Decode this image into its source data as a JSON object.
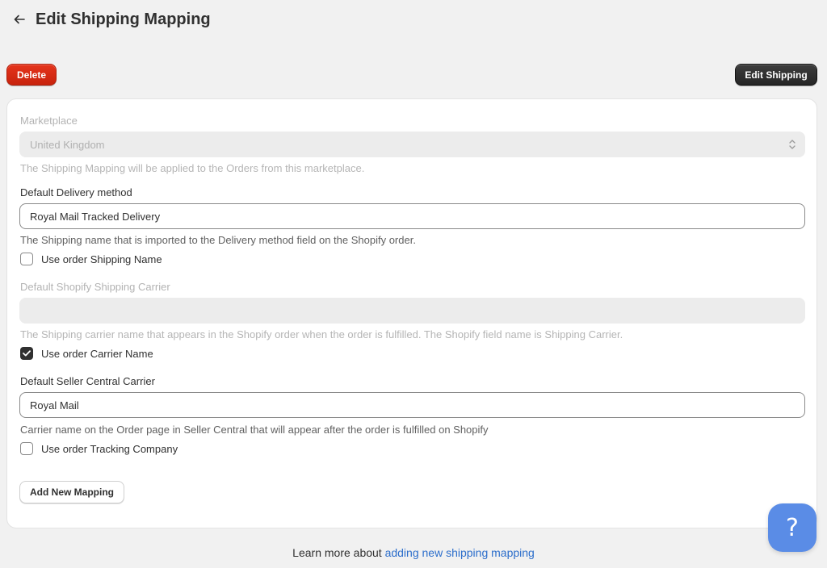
{
  "header": {
    "back_icon": "arrow-left-icon",
    "title": "Edit Shipping Mapping"
  },
  "toolbar": {
    "delete_label": "Delete",
    "edit_shipping_label": "Edit Shipping",
    "delete_color": "#d82c0d",
    "edit_color": "#303030"
  },
  "form": {
    "marketplace": {
      "label": "Marketplace",
      "value": "United Kingdom",
      "help": "The Shipping Mapping will be applied to the Orders from this marketplace.",
      "icon": "select-chevrons-icon"
    },
    "delivery_method": {
      "label": "Default Delivery method",
      "value": "Royal Mail Tracked Delivery",
      "help": "The Shipping name that is imported to the Delivery method field on the Shopify order.",
      "checkbox_label": "Use order Shipping Name",
      "checked": false
    },
    "shopify_carrier": {
      "label": "Default Shopify Shipping Carrier",
      "value": "",
      "help": "The Shipping carrier name that appears in the Shopify order when the order is fulfilled. The Shopify field name is Shipping Carrier.",
      "checkbox_label": "Use order Carrier Name",
      "checked": true
    },
    "seller_central_carrier": {
      "label": "Default Seller Central Carrier",
      "value": "Royal Mail",
      "help": "Carrier name on the Order page in Seller Central that will appear after the order is fulfilled on Shopify",
      "checkbox_label": "Use order Tracking Company",
      "checked": false
    },
    "add_mapping_label": "Add New Mapping"
  },
  "footer": {
    "prefix": "Learn more about ",
    "link_text": "adding new shipping mapping",
    "link_color": "#2c6ecb"
  },
  "help_button": {
    "glyph": "?",
    "icon": "question-icon",
    "color": "#5a8ce6"
  }
}
